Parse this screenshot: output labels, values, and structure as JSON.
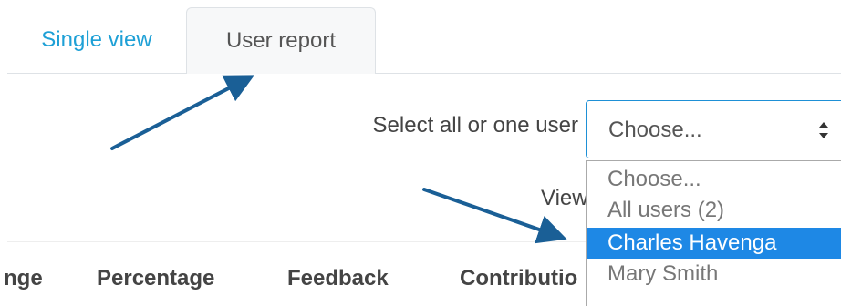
{
  "tabs": [
    {
      "label": "Single view"
    },
    {
      "label": "User report"
    }
  ],
  "user_select": {
    "label": "Select all or one user",
    "value": "Choose...",
    "options": [
      "Choose...",
      "All users (2)",
      "Charles Havenga",
      "Mary Smith"
    ],
    "highlighted_option": "Charles Havenga"
  },
  "view_text": "View",
  "table": {
    "columns": [
      "nge",
      "Percentage",
      "Feedback",
      "Contributio"
    ]
  },
  "colors": {
    "link": "#1ea0d6",
    "focus_border": "#1e90d6",
    "highlight": "#1e88e5",
    "annotation_arrow": "#1a5f96"
  },
  "annotations": [
    {
      "type": "arrow",
      "points_to": "tab-user-report"
    },
    {
      "type": "arrow",
      "points_to": "dropdown-option-charles-havenga"
    }
  ]
}
